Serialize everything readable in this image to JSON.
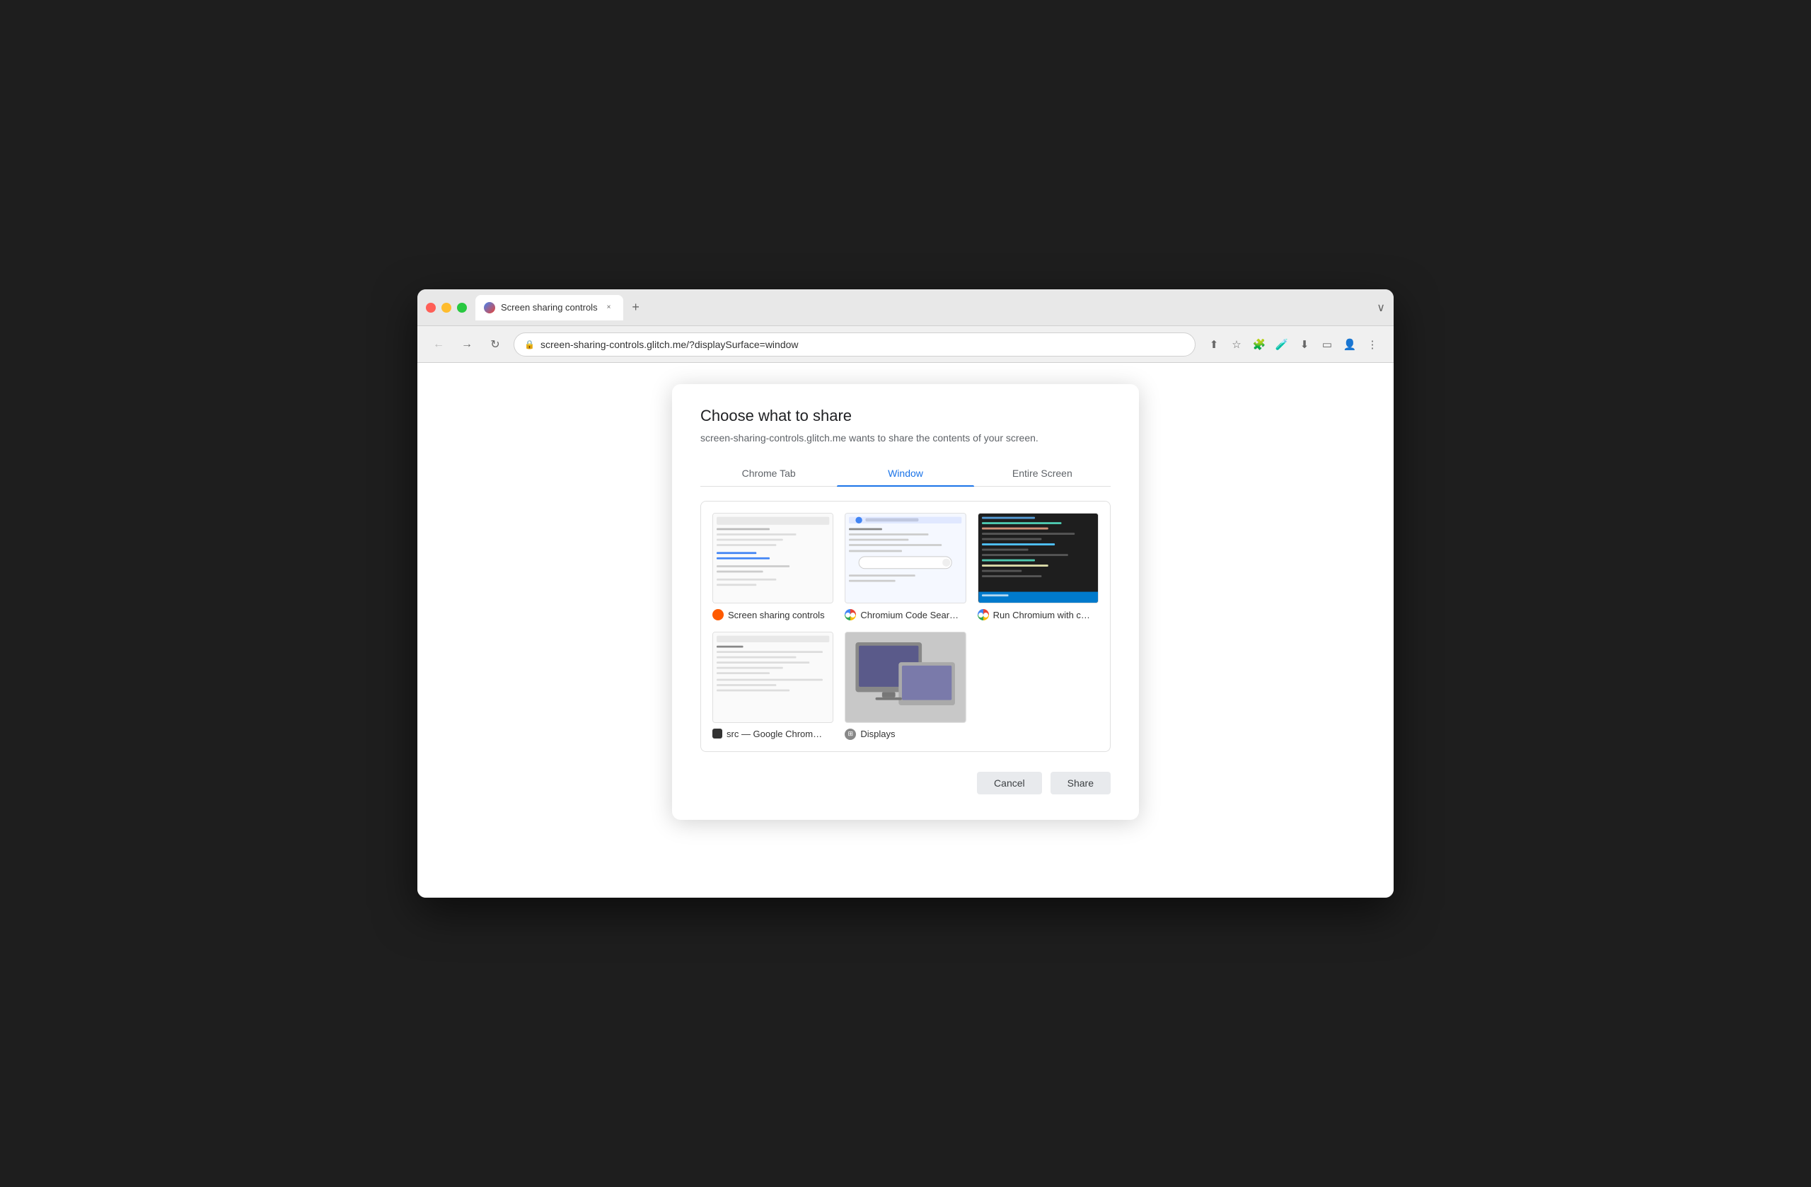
{
  "browser": {
    "tab_title": "Screen sharing controls",
    "tab_close_label": "×",
    "new_tab_label": "+",
    "window_controls_label": "∨",
    "url": "screen-sharing-controls.glitch.me/?displaySurface=window",
    "back_btn": "←",
    "forward_btn": "→",
    "refresh_btn": "↻"
  },
  "dialog": {
    "title": "Choose what to share",
    "subtitle": "screen-sharing-controls.glitch.me wants to share the contents of your screen.",
    "tabs": [
      {
        "id": "chrome-tab",
        "label": "Chrome Tab",
        "active": false
      },
      {
        "id": "window",
        "label": "Window",
        "active": true
      },
      {
        "id": "entire-screen",
        "label": "Entire Screen",
        "active": false
      }
    ],
    "windows": [
      {
        "id": "screen-sharing-controls",
        "label": "Screen sharing controls",
        "icon_type": "glitch"
      },
      {
        "id": "chromium-code-search",
        "label": "Chromium Code Searc...",
        "icon_type": "chrome"
      },
      {
        "id": "run-chromium",
        "label": "Run Chromium with co...",
        "icon_type": "chrome"
      },
      {
        "id": "src-google-chrome",
        "label": "src — Google Chrome...",
        "icon_type": "black-square"
      },
      {
        "id": "displays",
        "label": "Displays",
        "icon_type": "displays"
      }
    ],
    "cancel_label": "Cancel",
    "share_label": "Share"
  }
}
